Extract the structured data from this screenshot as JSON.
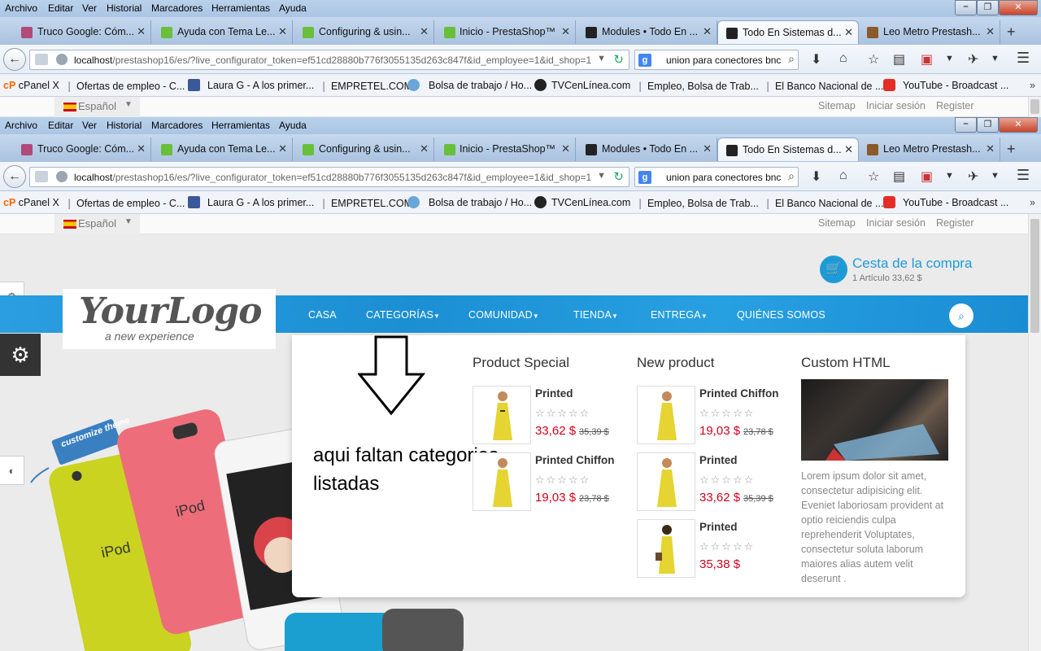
{
  "browser": {
    "menu": [
      "Archivo",
      "Editar",
      "Ver",
      "Historial",
      "Marcadores",
      "Herramientas",
      "Ayuda"
    ],
    "tabs": [
      {
        "label": "Truco Google: Cóm...",
        "icon_color": "#b04a7a"
      },
      {
        "label": "Ayuda con Tema Le...",
        "icon_color": "#6abf3a"
      },
      {
        "label": "Configuring & usin...",
        "icon_color": "#6abf3a"
      },
      {
        "label": "Inicio - PrestaShop™",
        "icon_color": "#6abf3a"
      },
      {
        "label": "Modules • Todo En ...",
        "icon_color": "#222222"
      },
      {
        "label": "Todo En Sistemas d...",
        "icon_color": "#222222"
      },
      {
        "label": "Leo Metro Prestash...",
        "icon_color": "#8a5a2a"
      }
    ],
    "active_tab_index": 5,
    "url_host": "localhost",
    "url_path": "/prestashop16/es/?live_configurator_token=ef51cd28880b776f3055135d263c847f&id_employee=1&id_shop=1",
    "search_value": "union para conectores bnc",
    "bookmarks": [
      "cPanel X",
      "Ofertas de empleo - C...",
      "Laura G - A los primer...",
      "EMPRETEL.COM",
      "Bolsa de trabajo / Ho...",
      "TVCenLínea.com",
      "Empleo, Bolsa de Trab...",
      "El Banco Nacional de ...",
      "YouTube - Broadcast ..."
    ]
  },
  "shop": {
    "language": "Español",
    "toplinks": [
      "Sitemap",
      "Iniciar sesión",
      "Register"
    ],
    "cart_title": "Cesta de la compra",
    "cart_summary": "1 Artículo 33,62 $",
    "logo_main": "YourLogo",
    "logo_sub": "a new experience",
    "nav": [
      "CASA",
      "CATEGORÍAS",
      "COMUNIDAD",
      "TIENDA",
      "ENTREGA",
      "QUIÉNES SOMOS"
    ],
    "hero_badge": "customize theme",
    "annotation_line1": "aqui faltan categorias",
    "annotation_line2": "listadas",
    "columns": [
      {
        "title": "Product Special",
        "products": [
          {
            "name": "Printed",
            "price": "33,62 $",
            "old_price": "35,39 $"
          },
          {
            "name": "Printed Chiffon",
            "price": "19,03 $",
            "old_price": "23,78 $"
          }
        ]
      },
      {
        "title": "New product",
        "products": [
          {
            "name": "Printed Chiffon",
            "price": "19,03 $",
            "old_price": "23,78 $"
          },
          {
            "name": "Printed",
            "price": "33,62 $",
            "old_price": "35,39 $"
          },
          {
            "name": "Printed",
            "price": "35,38 $",
            "old_price": ""
          }
        ]
      }
    ],
    "custom_html_title": "Custom HTML",
    "custom_html_text": "Lorem ipsum dolor sit amet, consectetur adipisicing elit. Eveniet laboriosam provident at optio reiciendis culpa reprehenderit Voluptates, consectetur soluta laborum maiores alias autem velit deserunt ."
  },
  "colors": {
    "accent_blue": "#1e9bd7",
    "price_red": "#d0021b",
    "dark_panel": "#333333"
  }
}
